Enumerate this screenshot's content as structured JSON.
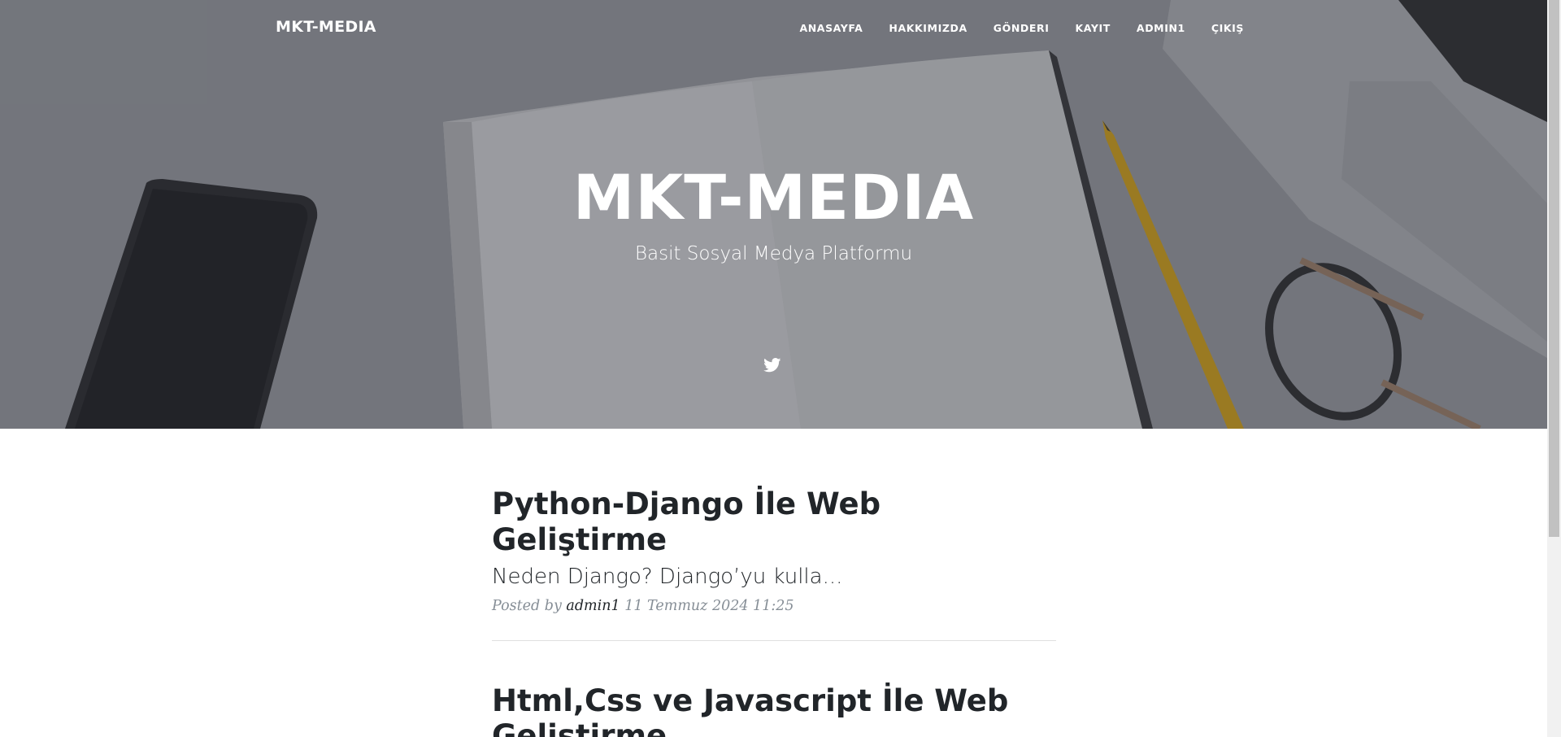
{
  "brand": "MKT-MEDIA",
  "nav": {
    "items": [
      {
        "label": "ANASAYFA"
      },
      {
        "label": "HAKKIMIZDA"
      },
      {
        "label": "GÖNDERI"
      },
      {
        "label": "KAYIT"
      },
      {
        "label": "ADMIN1"
      },
      {
        "label": "ÇIKIŞ"
      }
    ]
  },
  "hero": {
    "title": "MKT-MEDIA",
    "subtitle": "Basit Sosyal Medya Platformu",
    "social_icon": "twitter-icon"
  },
  "posts": [
    {
      "title": "Python-Django İle Web Geliştirme",
      "subtitle": "Neden Django? Django’yu kulla...",
      "meta_prefix": "Posted by",
      "author": "admin1",
      "date": "11 Temmuz 2024 11:25"
    },
    {
      "title": "Html,Css ve Javascript İle Web Geliştirme"
    }
  ],
  "colors": {
    "text_dark": "#212529",
    "meta_gray": "#868e96",
    "white": "#ffffff"
  }
}
